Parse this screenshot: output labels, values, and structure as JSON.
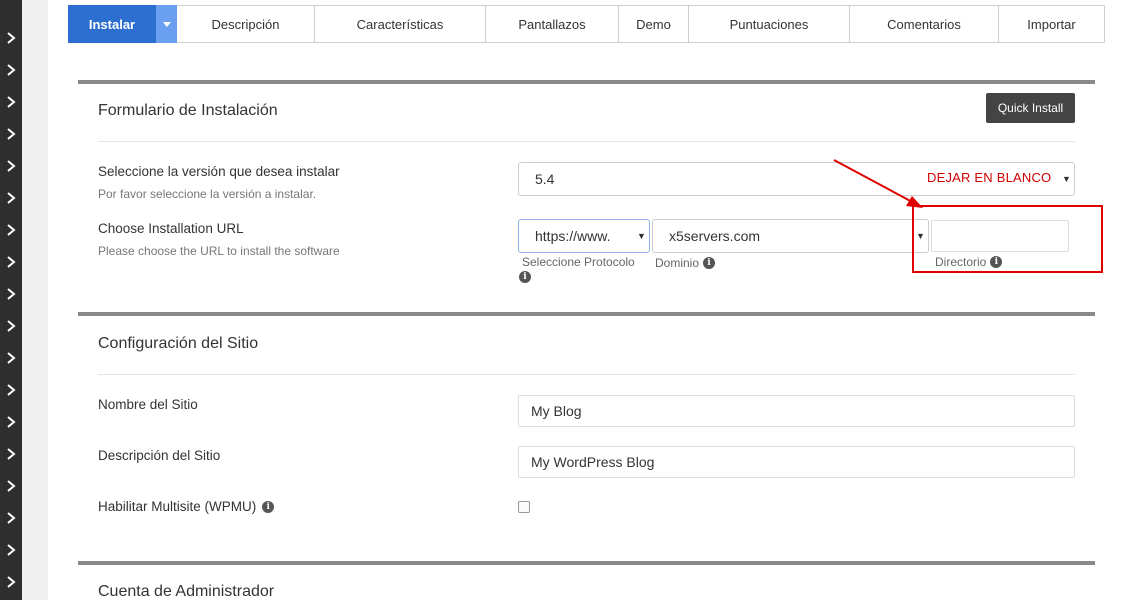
{
  "tabs": [
    {
      "label": "Instalar",
      "active": true
    },
    {
      "label": "Descripción"
    },
    {
      "label": "Características"
    },
    {
      "label": "Pantallazos"
    },
    {
      "label": "Demo"
    },
    {
      "label": "Puntuaciones"
    },
    {
      "label": "Comentarios"
    },
    {
      "label": "Importar"
    }
  ],
  "install_form": {
    "title": "Formulario de Instalación",
    "quick_install_label": "Quick Install",
    "version": {
      "label": "Seleccione la versión que desea instalar",
      "sublabel": "Por favor seleccione la versión a instalar.",
      "value": "5.4"
    },
    "url": {
      "label": "Choose Installation URL",
      "sublabel": "Please choose the URL to install the software",
      "protocol_value": "https://www.",
      "protocol_hint": "Seleccione Protocolo",
      "domain_value": "x5servers.com",
      "domain_hint": "Dominio",
      "directory_value": "",
      "directory_hint": "Directorio"
    }
  },
  "annotation": {
    "text": "DEJAR EN BLANCO",
    "color": "#e00000"
  },
  "site_config": {
    "title": "Configuración del Sitio",
    "site_name_label": "Nombre del Sitio",
    "site_name_value": "My Blog",
    "site_desc_label": "Descripción del Sitio",
    "site_desc_value": "My WordPress Blog",
    "multisite_label": "Habilitar Multisite (WPMU)",
    "multisite_checked": false
  },
  "admin_account": {
    "title": "Cuenta de Administrador"
  },
  "colors": {
    "accent": "#2d6fd0",
    "accent_light": "#6aa0ef",
    "rail": "#2e2e2e",
    "button": "#444444"
  }
}
